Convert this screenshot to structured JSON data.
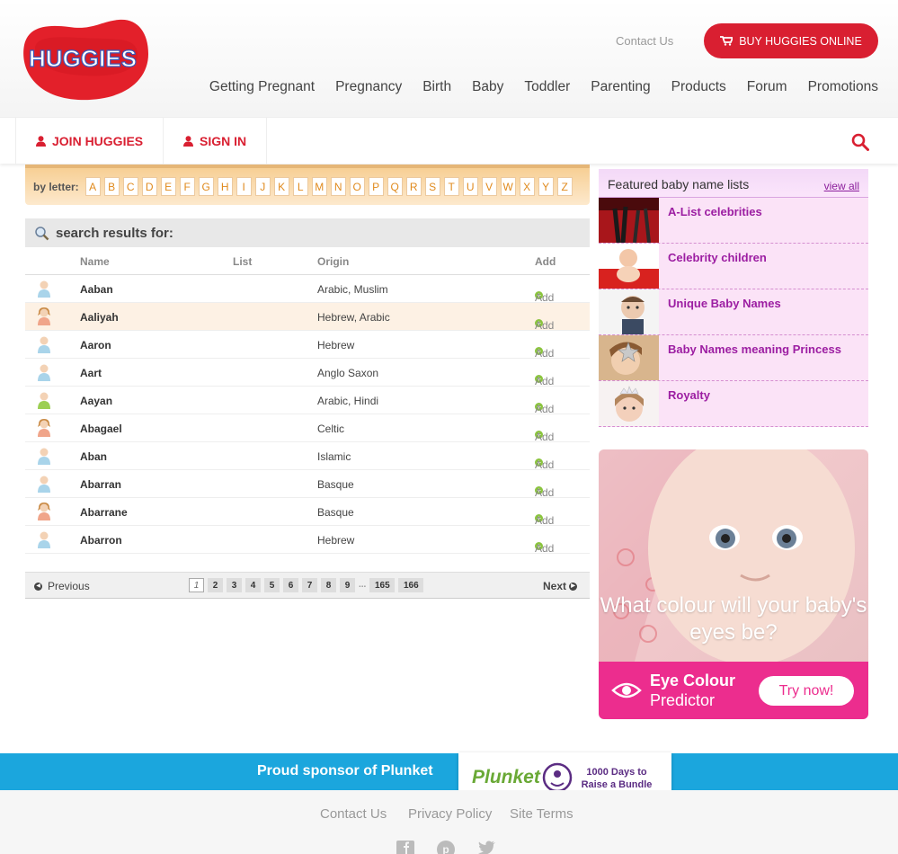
{
  "header": {
    "logo_text": "HUGGIES",
    "contact": "Contact Us",
    "buy_button": "BUY HUGGIES ONLINE",
    "nav": [
      "Getting Pregnant",
      "Pregnancy",
      "Birth",
      "Baby",
      "Toddler",
      "Parenting",
      "Products",
      "Forum",
      "Promotions"
    ]
  },
  "subbar": {
    "join": "JOIN HUGGIES",
    "signin": "SIGN IN"
  },
  "letters": {
    "label": "by letter:",
    "items": [
      "A",
      "B",
      "C",
      "D",
      "E",
      "F",
      "G",
      "H",
      "I",
      "J",
      "K",
      "L",
      "M",
      "N",
      "O",
      "P",
      "Q",
      "R",
      "S",
      "T",
      "U",
      "V",
      "W",
      "X",
      "Y",
      "Z"
    ]
  },
  "results": {
    "heading": "search results for:",
    "columns": {
      "name": "Name",
      "list": "List",
      "origin": "Origin",
      "add": "Add"
    },
    "add_label": "Add",
    "rows": [
      {
        "name": "Aaban",
        "origin": "Arabic, Muslim",
        "gender": "boy"
      },
      {
        "name": "Aaliyah",
        "origin": "Hebrew, Arabic",
        "gender": "girl"
      },
      {
        "name": "Aaron",
        "origin": "Hebrew",
        "gender": "boy"
      },
      {
        "name": "Aart",
        "origin": "Anglo Saxon",
        "gender": "boy"
      },
      {
        "name": "Aayan",
        "origin": "Arabic, Hindi",
        "gender": "unisex"
      },
      {
        "name": "Abagael",
        "origin": "Celtic",
        "gender": "girl"
      },
      {
        "name": "Aban",
        "origin": "Islamic",
        "gender": "boy"
      },
      {
        "name": "Abarran",
        "origin": "Basque",
        "gender": "boy"
      },
      {
        "name": "Abarrane",
        "origin": "Basque",
        "gender": "girl"
      },
      {
        "name": "Abarron",
        "origin": "Hebrew",
        "gender": "boy"
      }
    ]
  },
  "pager": {
    "previous": "Previous",
    "next": "Next",
    "pages": [
      "1",
      "2",
      "3",
      "4",
      "5",
      "6",
      "7",
      "8",
      "9"
    ],
    "ellipsis": "...",
    "last_pages": [
      "165",
      "166"
    ]
  },
  "featured": {
    "title": "Featured baby name lists",
    "view_all": "view all",
    "lists": [
      "A-List celebrities",
      "Celebrity children",
      "Unique Baby Names",
      "Baby Names meaning Princess",
      "Royalty"
    ]
  },
  "ad": {
    "question": "What colour will your baby's eyes be?",
    "line1": "Eye Colour",
    "line2": "Predictor",
    "button": "Try now!"
  },
  "sponsor": {
    "text": "Proud sponsor of Plunket",
    "plunket": "Plunket",
    "days": "1000 Days to Raise a Bundle"
  },
  "footer": {
    "links": [
      "Contact Us",
      "Privacy Policy",
      "Site Terms"
    ]
  },
  "colors": {
    "brand_red": "#d91f31",
    "link_purple": "#9c1ea2",
    "sponsor_blue": "#1ba6dd",
    "ad_pink": "#ec2d8e"
  }
}
